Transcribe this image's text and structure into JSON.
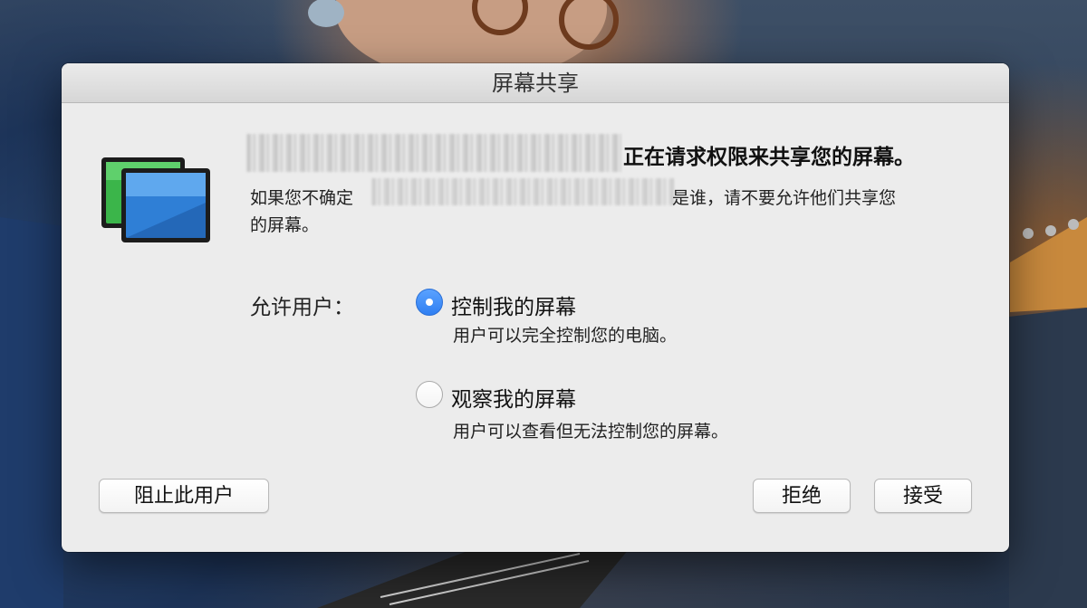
{
  "window": {
    "title": "屏幕共享"
  },
  "request": {
    "headline_suffix": "正在请求权限来共享您的屏幕。",
    "warning_prefix": "如果您不确定",
    "warning_suffix_line1": "是谁，请不要允许他们共享您",
    "warning_suffix_line2": "的屏幕。"
  },
  "permission": {
    "label": "允许用户：",
    "selected": "control",
    "options": [
      {
        "id": "control",
        "title": "控制我的屏幕",
        "description": "用户可以完全控制您的电脑。"
      },
      {
        "id": "observe",
        "title": "观察我的屏幕",
        "description": "用户可以查看但无法控制您的屏幕。"
      }
    ]
  },
  "buttons": {
    "block_user": "阻止此用户",
    "reject": "拒绝",
    "accept": "接受"
  },
  "colors": {
    "accent": "#3b8cf7",
    "dialog_bg": "#ececec",
    "titlebar_bg": "#dcdcdc"
  },
  "icons": {
    "app": "screen-sharing-icon"
  }
}
